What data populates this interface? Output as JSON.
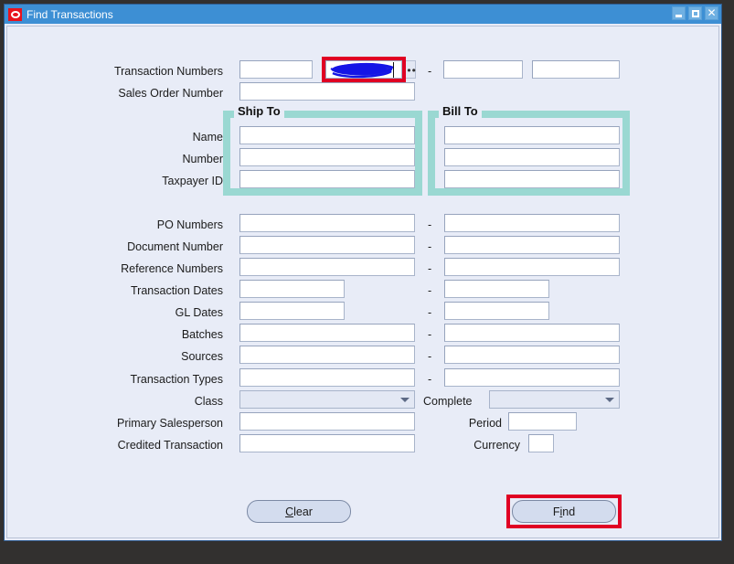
{
  "window": {
    "title": "Find Transactions",
    "logo_icon": "oracle-logo-icon",
    "controls": {
      "minimize": "minimize-icon",
      "maximize": "maximize-icon",
      "close": "close-icon",
      "close_glyph": "✕"
    }
  },
  "colors": {
    "titlebar": "#3d8fd4",
    "canvas": "#e8ecf7",
    "group_border": "#9ad8d2",
    "highlight": "#e00023",
    "scribble": "#1414e6",
    "field_bg": "#ffffff",
    "button_bg": "#d3dcee"
  },
  "form": {
    "top_rows": [
      {
        "label": "Transaction Numbers",
        "value": "",
        "value2": "",
        "value3": "",
        "value4": "",
        "lov": "•••",
        "highlighted": true,
        "redacted": true
      },
      {
        "label": "Sales Order Number",
        "value": ""
      }
    ],
    "groups": [
      {
        "title": "Ship To",
        "fields": [
          {
            "label": "Name",
            "value": ""
          },
          {
            "label": "Number",
            "value": ""
          },
          {
            "label": "Taxpayer ID",
            "value": ""
          }
        ]
      },
      {
        "title": "Bill To",
        "fields": [
          {
            "value": ""
          },
          {
            "value": ""
          },
          {
            "value": ""
          }
        ]
      }
    ],
    "range_rows": [
      {
        "label": "PO Numbers",
        "from": "",
        "to": "",
        "separator": "-",
        "narrow": false
      },
      {
        "label": "Document Number",
        "from": "",
        "to": "",
        "separator": "-",
        "narrow": false
      },
      {
        "label": "Reference Numbers",
        "from": "",
        "to": "",
        "separator": "-",
        "narrow": false
      },
      {
        "label": "Transaction Dates",
        "from": "",
        "to": "",
        "separator": "-",
        "narrow": true
      },
      {
        "label": "GL Dates",
        "from": "",
        "to": "",
        "separator": "-",
        "narrow": true
      },
      {
        "label": "Batches",
        "from": "",
        "to": "",
        "separator": "-",
        "narrow": false
      },
      {
        "label": "Sources",
        "from": "",
        "to": "",
        "separator": "-",
        "narrow": false
      },
      {
        "label": "Transaction Types",
        "from": "",
        "to": "",
        "separator": "-",
        "narrow": false
      }
    ],
    "class_row": {
      "label": "Class",
      "value": "",
      "arrow_icon": "chevron-down-icon",
      "complete_label": "Complete",
      "complete_value": "",
      "complete_arrow_icon": "chevron-down-icon"
    },
    "salesperson_row": {
      "label": "Primary Salesperson",
      "value": "",
      "period_label": "Period",
      "period_value": ""
    },
    "credited_row": {
      "label": "Credited Transaction",
      "value": "",
      "currency_label": "Currency",
      "currency_value": ""
    }
  },
  "buttons": {
    "clear": {
      "text_before": "",
      "mnemonic": "C",
      "text_after": "lear",
      "full": "Clear",
      "highlighted": false
    },
    "find": {
      "text_before": "F",
      "mnemonic": "i",
      "text_after": "nd",
      "full": "Find",
      "highlighted": true
    }
  }
}
